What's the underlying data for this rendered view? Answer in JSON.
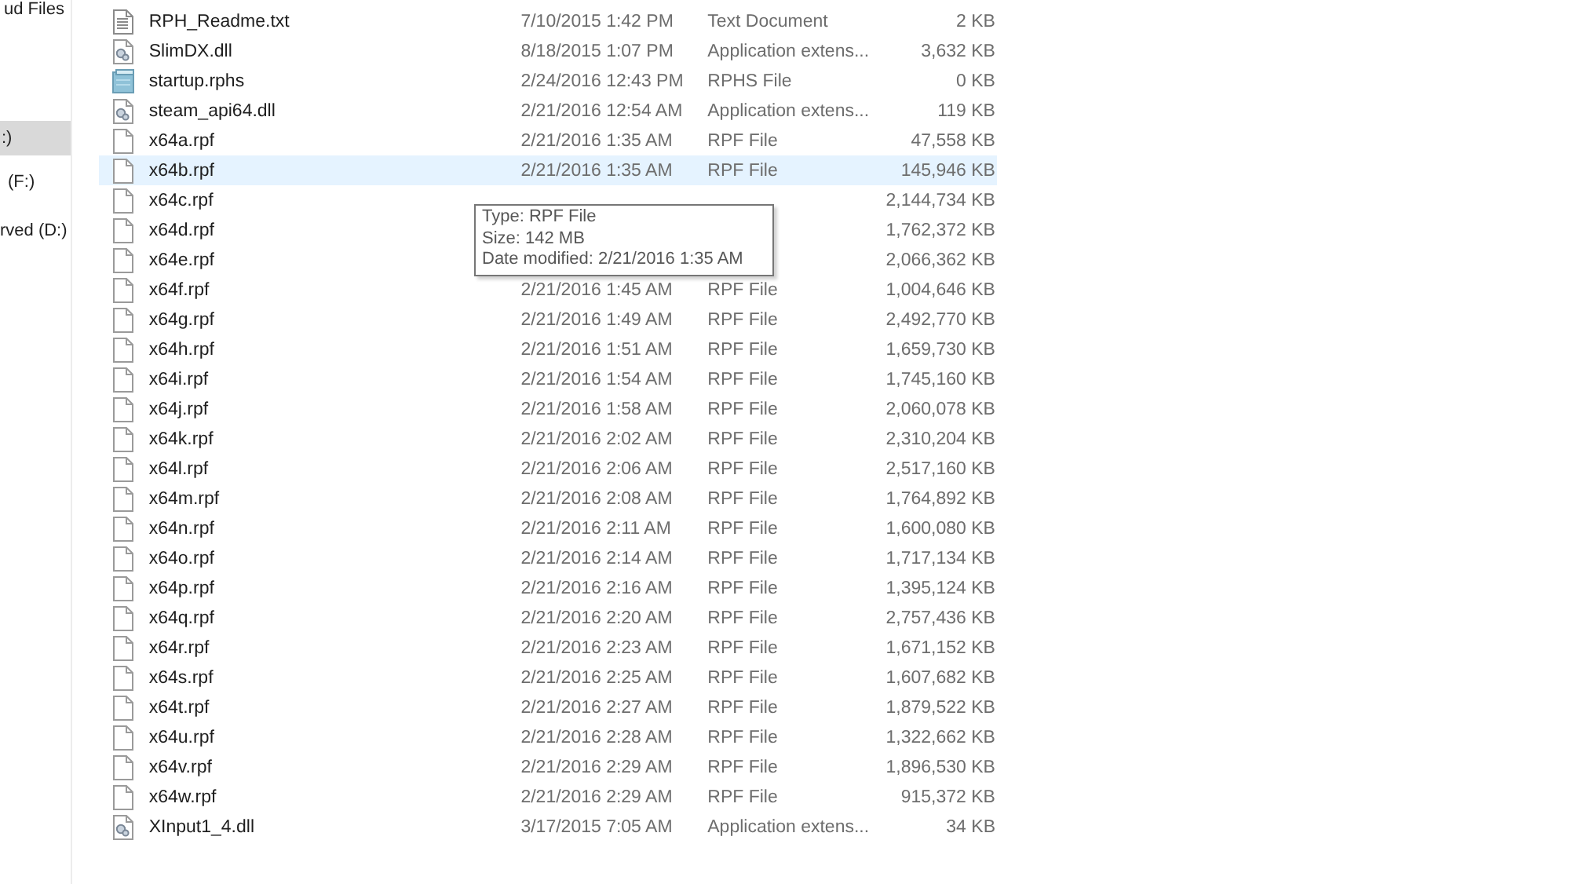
{
  "sidebar": {
    "items": [
      {
        "label": "ud Files",
        "selected": false
      },
      {
        "label": ":)",
        "selected": true
      },
      {
        "label": "(F:)",
        "selected": false
      },
      {
        "label": "rved (D:)",
        "selected": false
      }
    ]
  },
  "files": [
    {
      "name": "RPH_Readme.txt",
      "kind": "text",
      "date": "7/10/2015 1:42 PM",
      "type": "Text Document",
      "size": "2 KB",
      "hovered": false
    },
    {
      "name": "SlimDX.dll",
      "kind": "dll",
      "date": "8/18/2015 1:07 PM",
      "type": "Application extens...",
      "size": "3,632 KB",
      "hovered": false
    },
    {
      "name": "startup.rphs",
      "kind": "script",
      "date": "2/24/2016 12:43 PM",
      "type": "RPHS File",
      "size": "0 KB",
      "hovered": false
    },
    {
      "name": "steam_api64.dll",
      "kind": "dll",
      "date": "2/21/2016 12:54 AM",
      "type": "Application extens...",
      "size": "119 KB",
      "hovered": false
    },
    {
      "name": "x64a.rpf",
      "kind": "blank",
      "date": "2/21/2016 1:35 AM",
      "type": "RPF File",
      "size": "47,558 KB",
      "hovered": false
    },
    {
      "name": "x64b.rpf",
      "kind": "blank",
      "date": "2/21/2016 1:35 AM",
      "type": "RPF File",
      "size": "145,946 KB",
      "hovered": true
    },
    {
      "name": "x64c.rpf",
      "kind": "blank",
      "size": "2,144,734 KB",
      "hovered": false
    },
    {
      "name": "x64d.rpf",
      "kind": "blank",
      "size": "1,762,372 KB",
      "hovered": false
    },
    {
      "name": "x64e.rpf",
      "kind": "blank",
      "size": "2,066,362 KB",
      "hovered": false
    },
    {
      "name": "x64f.rpf",
      "kind": "blank",
      "date": "2/21/2016 1:45 AM",
      "type": "RPF File",
      "size": "1,004,646 KB",
      "hovered": false
    },
    {
      "name": "x64g.rpf",
      "kind": "blank",
      "date": "2/21/2016 1:49 AM",
      "type": "RPF File",
      "size": "2,492,770 KB",
      "hovered": false
    },
    {
      "name": "x64h.rpf",
      "kind": "blank",
      "date": "2/21/2016 1:51 AM",
      "type": "RPF File",
      "size": "1,659,730 KB",
      "hovered": false
    },
    {
      "name": "x64i.rpf",
      "kind": "blank",
      "date": "2/21/2016 1:54 AM",
      "type": "RPF File",
      "size": "1,745,160 KB",
      "hovered": false
    },
    {
      "name": "x64j.rpf",
      "kind": "blank",
      "date": "2/21/2016 1:58 AM",
      "type": "RPF File",
      "size": "2,060,078 KB",
      "hovered": false
    },
    {
      "name": "x64k.rpf",
      "kind": "blank",
      "date": "2/21/2016 2:02 AM",
      "type": "RPF File",
      "size": "2,310,204 KB",
      "hovered": false
    },
    {
      "name": "x64l.rpf",
      "kind": "blank",
      "date": "2/21/2016 2:06 AM",
      "type": "RPF File",
      "size": "2,517,160 KB",
      "hovered": false
    },
    {
      "name": "x64m.rpf",
      "kind": "blank",
      "date": "2/21/2016 2:08 AM",
      "type": "RPF File",
      "size": "1,764,892 KB",
      "hovered": false
    },
    {
      "name": "x64n.rpf",
      "kind": "blank",
      "date": "2/21/2016 2:11 AM",
      "type": "RPF File",
      "size": "1,600,080 KB",
      "hovered": false
    },
    {
      "name": "x64o.rpf",
      "kind": "blank",
      "date": "2/21/2016 2:14 AM",
      "type": "RPF File",
      "size": "1,717,134 KB",
      "hovered": false
    },
    {
      "name": "x64p.rpf",
      "kind": "blank",
      "date": "2/21/2016 2:16 AM",
      "type": "RPF File",
      "size": "1,395,124 KB",
      "hovered": false
    },
    {
      "name": "x64q.rpf",
      "kind": "blank",
      "date": "2/21/2016 2:20 AM",
      "type": "RPF File",
      "size": "2,757,436 KB",
      "hovered": false
    },
    {
      "name": "x64r.rpf",
      "kind": "blank",
      "date": "2/21/2016 2:23 AM",
      "type": "RPF File",
      "size": "1,671,152 KB",
      "hovered": false
    },
    {
      "name": "x64s.rpf",
      "kind": "blank",
      "date": "2/21/2016 2:25 AM",
      "type": "RPF File",
      "size": "1,607,682 KB",
      "hovered": false
    },
    {
      "name": "x64t.rpf",
      "kind": "blank",
      "date": "2/21/2016 2:27 AM",
      "type": "RPF File",
      "size": "1,879,522 KB",
      "hovered": false
    },
    {
      "name": "x64u.rpf",
      "kind": "blank",
      "date": "2/21/2016 2:28 AM",
      "type": "RPF File",
      "size": "1,322,662 KB",
      "hovered": false
    },
    {
      "name": "x64v.rpf",
      "kind": "blank",
      "date": "2/21/2016 2:29 AM",
      "type": "RPF File",
      "size": "1,896,530 KB",
      "hovered": false
    },
    {
      "name": "x64w.rpf",
      "kind": "blank",
      "date": "2/21/2016 2:29 AM",
      "type": "RPF File",
      "size": "915,372 KB",
      "hovered": false
    },
    {
      "name": "XInput1_4.dll",
      "kind": "dll",
      "date": "3/17/2015 7:05 AM",
      "type": "Application extens...",
      "size": "34 KB",
      "hovered": false
    }
  ],
  "tooltip": {
    "lines": [
      "Type: RPF File",
      "Size: 142 MB",
      "Date modified: 2/21/2016 1:35 AM"
    ]
  }
}
